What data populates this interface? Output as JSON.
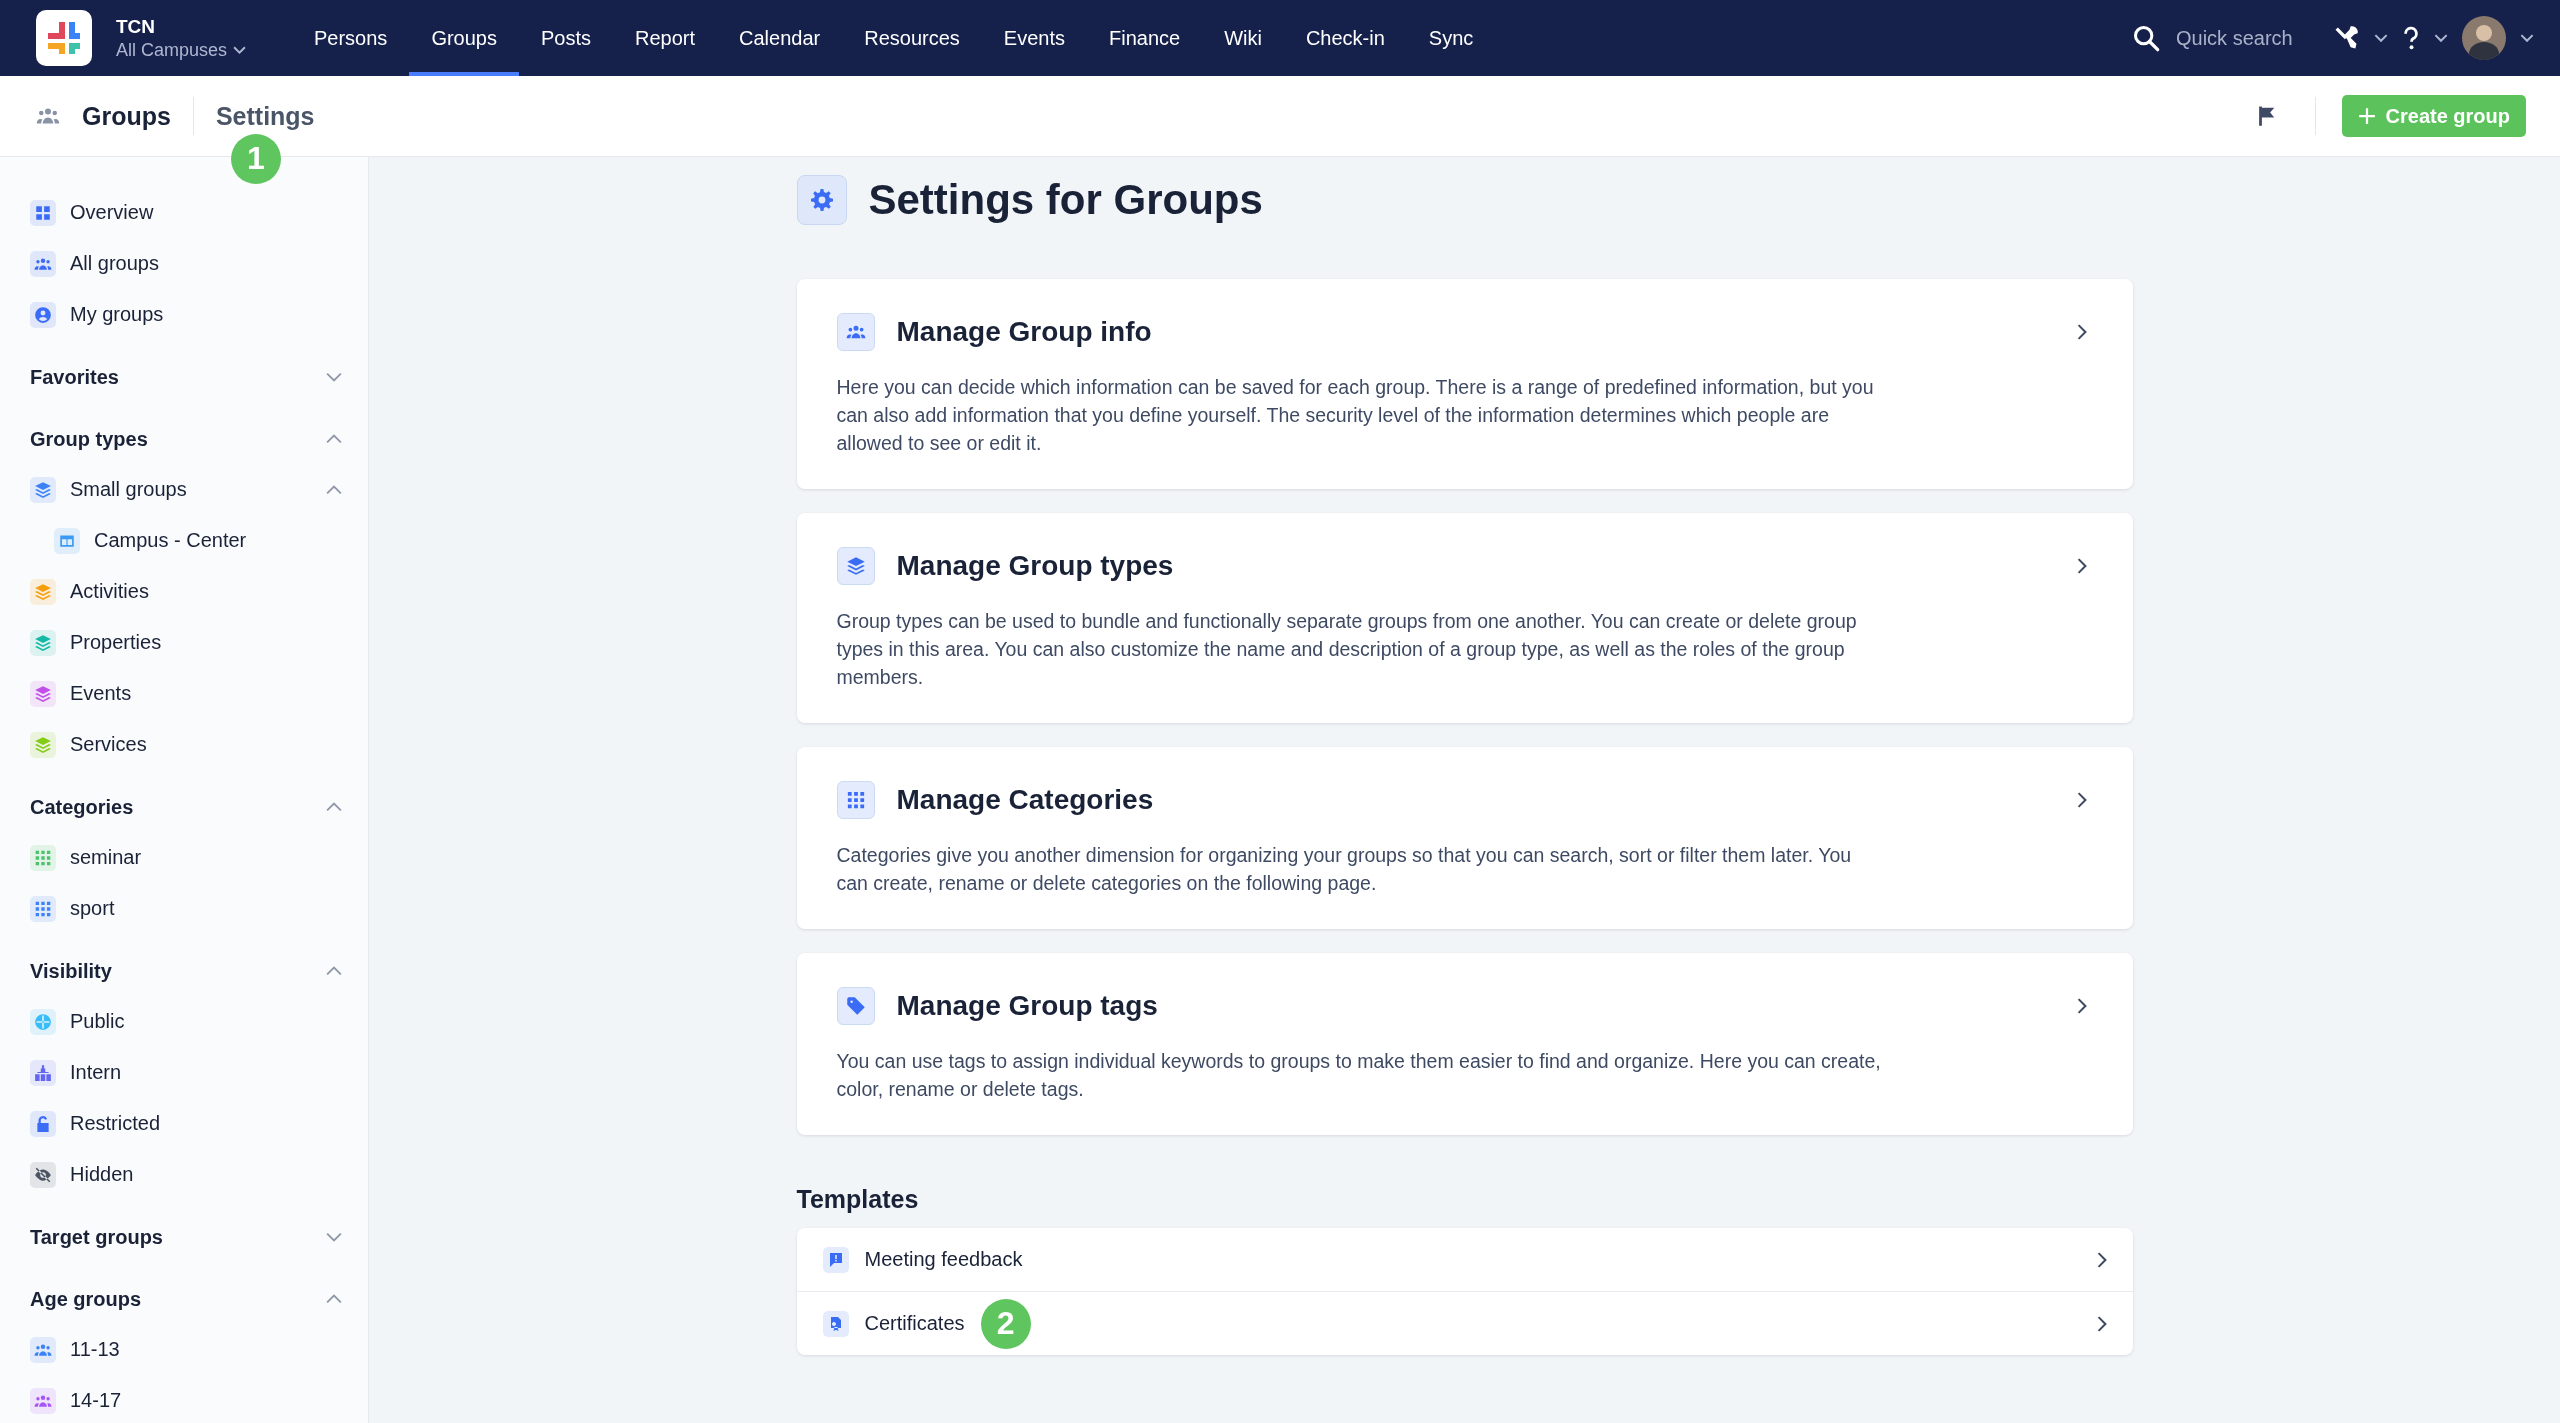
{
  "app": {
    "name": "TCN",
    "campus": "All Campuses"
  },
  "nav": [
    {
      "label": "Persons",
      "selected": false
    },
    {
      "label": "Groups",
      "selected": true
    },
    {
      "label": "Posts",
      "selected": false
    },
    {
      "label": "Report",
      "selected": false
    },
    {
      "label": "Calendar",
      "selected": false
    },
    {
      "label": "Resources",
      "selected": false
    },
    {
      "label": "Events",
      "selected": false
    },
    {
      "label": "Finance",
      "selected": false
    },
    {
      "label": "Wiki",
      "selected": false
    },
    {
      "label": "Check-in",
      "selected": false
    },
    {
      "label": "Sync",
      "selected": false
    }
  ],
  "quick_search": {
    "placeholder": "Quick search"
  },
  "breadcrumb": {
    "section": "Groups",
    "page": "Settings",
    "callout": "1"
  },
  "create_button": "Create group",
  "sidebar": {
    "links": [
      {
        "label": "Overview",
        "color": "#3b6cf6"
      },
      {
        "label": "All groups",
        "color": "#3b6cf6"
      },
      {
        "label": "My groups",
        "color": "#3b6cf6"
      }
    ],
    "sections": [
      {
        "title": "Favorites",
        "expanded": false
      },
      {
        "title": "Group types",
        "expanded": true,
        "items": [
          {
            "label": "Small groups",
            "color": "#3b82f6",
            "expanded": true,
            "children": [
              {
                "label": "Campus - Center",
                "color": "#3b9af6"
              }
            ]
          },
          {
            "label": "Activities",
            "color": "#f59e0b"
          },
          {
            "label": "Properties",
            "color": "#14b8a6"
          },
          {
            "label": "Events",
            "color": "#c14fe8"
          },
          {
            "label": "Services",
            "color": "#84cc16"
          }
        ]
      },
      {
        "title": "Categories",
        "expanded": true,
        "items": [
          {
            "label": "seminar",
            "color": "#4cc26a"
          },
          {
            "label": "sport",
            "color": "#3b82f6"
          }
        ]
      },
      {
        "title": "Visibility",
        "expanded": true,
        "items": [
          {
            "label": "Public",
            "color": "#38bdf8"
          },
          {
            "label": "Intern",
            "color": "#6366f1"
          },
          {
            "label": "Restricted",
            "color": "#3b6cf6"
          },
          {
            "label": "Hidden",
            "color": "#4b5563"
          }
        ]
      },
      {
        "title": "Target groups",
        "expanded": false
      },
      {
        "title": "Age groups",
        "expanded": true,
        "items": [
          {
            "label": "11-13",
            "color": "#3b82f6"
          },
          {
            "label": "14-17",
            "color": "#a855f7"
          }
        ]
      }
    ]
  },
  "page": {
    "title": "Settings for Groups",
    "cards": [
      {
        "title": "Manage Group info",
        "description": "Here you can decide which information can be saved for each group. There is a range of predefined information, but you can also add information that you define yourself. The security level of the information determines which people are allowed to see or edit it."
      },
      {
        "title": "Manage Group types",
        "description": "Group types can be used to bundle and functionally separate groups from one another. You can create or delete group types in this area. You can also customize the name and description of a group type, as well as the roles of the group members."
      },
      {
        "title": "Manage Categories",
        "description": "Categories give you another dimension for organizing your groups so that you can search, sort or filter them later. You can create, rename or delete categories on the following page."
      },
      {
        "title": "Manage Group tags",
        "description": "You can use tags to assign individual keywords to groups to make them easier to find and organize. Here you can create, color, rename or delete tags."
      }
    ],
    "templates": {
      "title": "Templates",
      "items": [
        {
          "label": "Meeting feedback"
        },
        {
          "label": "Certificates",
          "callout": "2"
        }
      ]
    }
  }
}
